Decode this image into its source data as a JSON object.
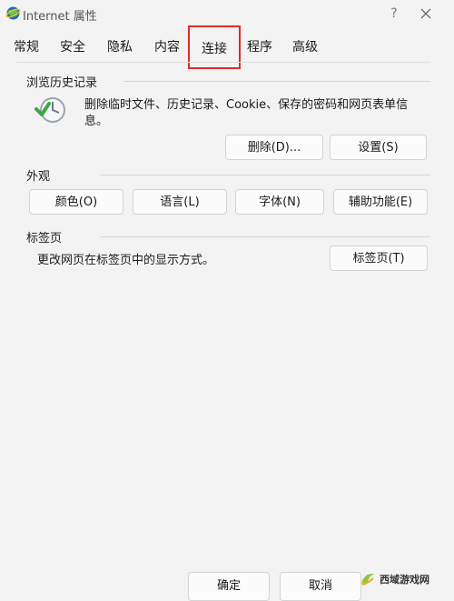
{
  "window": {
    "title": "Internet 属性",
    "help_label": "?"
  },
  "tabs": [
    {
      "label": "常规"
    },
    {
      "label": "安全"
    },
    {
      "label": "隐私"
    },
    {
      "label": "内容"
    },
    {
      "label": "连接"
    },
    {
      "label": "程序"
    },
    {
      "label": "高级"
    }
  ],
  "browsing_history": {
    "title": "浏览历史记录",
    "description": "删除临时文件、历史记录、Cookie、保存的密码和网页表单信息。",
    "delete_button": "删除(D)...",
    "settings_button": "设置(S)"
  },
  "appearance": {
    "title": "外观",
    "colors_button": "颜色(O)",
    "languages_button": "语言(L)",
    "fonts_button": "字体(N)",
    "accessibility_button": "辅助功能(E)"
  },
  "tab_pages": {
    "title": "标签页",
    "description": "更改网页在标签页中的显示方式。",
    "tabs_button": "标签页(T)"
  },
  "footer": {
    "ok_button": "确定",
    "cancel_button": "取消"
  },
  "watermark": {
    "text": "西域游戏网"
  },
  "colors": {
    "highlight": "#e12b2b"
  }
}
